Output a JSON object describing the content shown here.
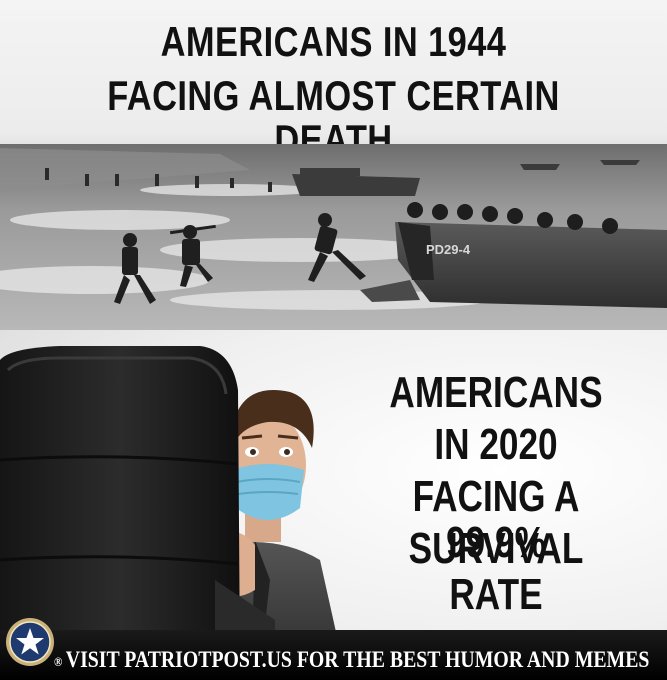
{
  "top_panel": {
    "headline_line_1": "AMERICANS IN 1944",
    "headline_line_2": "FACING ALMOST CERTAIN DEATH",
    "boat_marking": "PD29-4"
  },
  "bottom_panel": {
    "line_1": "AMERICANS",
    "line_2": "IN 2020",
    "line_3": "FACING A 99.9%",
    "line_4": "SURVIVAL RATE"
  },
  "footer": {
    "bullet": "®",
    "text": "VISIT PATRIOTPOST.US FOR THE BEST HUMOR AND MEMES"
  },
  "colors": {
    "headline_text": "#111111",
    "footer_background": "#000000",
    "footer_text": "#ffffff",
    "mask_blue": "#7fc4e0",
    "logo_ring": "#c9b27a",
    "logo_center": "#1e3a6e"
  }
}
